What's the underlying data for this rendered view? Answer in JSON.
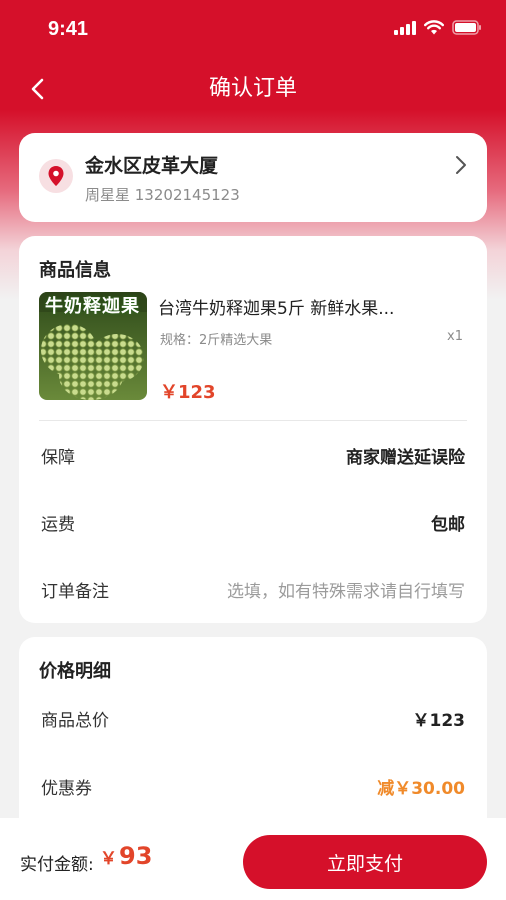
{
  "status_bar": {
    "time": "9:41"
  },
  "header": {
    "title": "确认订单"
  },
  "address": {
    "line": "金水区皮革大厦",
    "contact": "周星星 13202145123"
  },
  "goods": {
    "section_title": "商品信息",
    "image_caption": "牛奶释迦果",
    "product_name": "台湾牛奶释迦果5斤 新鲜水果...",
    "spec": "规格：2斤精选大果",
    "quantity": "x1",
    "price": "￥123",
    "rows": {
      "guarantee_label": "保障",
      "guarantee_value": "商家赠送延误险",
      "shipping_label": "运费",
      "shipping_value": "包邮",
      "note_label": "订单备注",
      "note_placeholder": "选填，如有特殊需求请自行填写"
    }
  },
  "price_detail": {
    "section_title": "价格明细",
    "subtotal_label": "商品总价",
    "subtotal_value": "￥123",
    "coupon_label": "优惠券",
    "coupon_value": "减￥30.00"
  },
  "checkout": {
    "total_label": "实付金额:",
    "currency": "￥",
    "total_amount": "93",
    "pay_button": "立即支付"
  },
  "colors": {
    "brand_red": "#d5102a",
    "price_red": "#e2452a",
    "discount_orange": "#f08a2a"
  }
}
